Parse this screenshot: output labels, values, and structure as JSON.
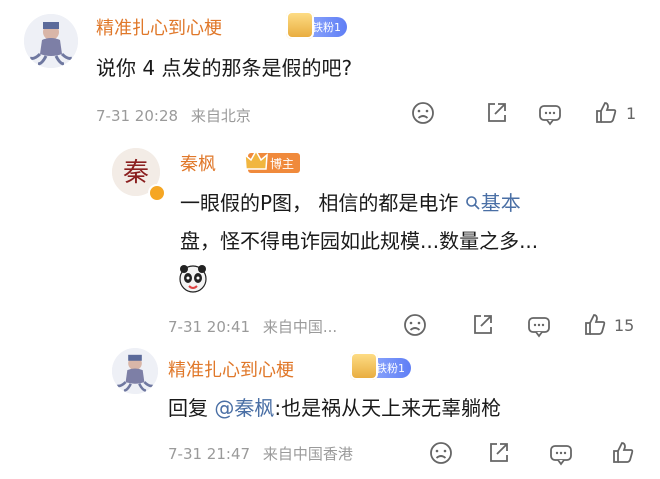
{
  "comment1": {
    "author": "精准扎心到心梗",
    "badge": "铁粉1",
    "text": "说你 4 点发的那条是假的吧?",
    "time": "7-31 20:28",
    "location": "来自北京",
    "likes": "1"
  },
  "comment2": {
    "author": "秦枫",
    "badge": "博主",
    "text_line1_a": "一眼假的P图，  相信的都是电诈",
    "search_link": "基本",
    "text_line2": "盘，怪不得电诈园如此规模...数量之多...",
    "time": "7-31 20:41",
    "location": "来自中国...",
    "likes": "15"
  },
  "comment3": {
    "author": "精准扎心到心梗",
    "badge": "铁粉1",
    "reply_prefix": "回复",
    "mention": "@秦枫",
    "text": ":也是祸从天上来无辜躺枪",
    "time": "7-31 21:47",
    "location": "来自中国香港"
  },
  "icons": {
    "dislike": "sad-face-icon",
    "share": "share-icon",
    "comment": "comment-icon",
    "like": "thumb-up-icon"
  },
  "colors": {
    "name_orange": "#e0782a",
    "link_blue": "#4a6fa5",
    "meta_gray": "#9a9a9a"
  }
}
